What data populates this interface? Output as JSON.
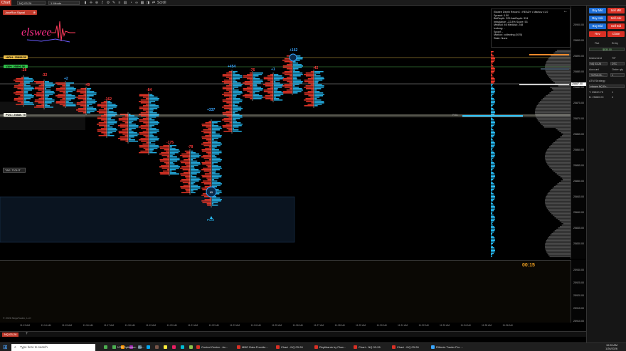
{
  "toolbar": {
    "chart_tab": "Chart",
    "instrument": "NQ 03-26",
    "interval": "1 Minute",
    "scroll_label": "Scroll"
  },
  "logo": {
    "badge": "JoseRon Signal",
    "wordmark": "elswee"
  },
  "levels": {
    "vah": "VAH: 25896.50",
    "val": "VAH: 25896.50",
    "high_label": "HIGH: 25898.50",
    "val_label": "VAH: 25896.50",
    "poc_label": "POC: 25880.75",
    "poc_right": "POC"
  },
  "tag_tight": "TAE: TIGHT",
  "deltas": [
    {
      "text": "-28",
      "color": "red"
    },
    {
      "text": "-32",
      "color": "red"
    },
    {
      "text": "+2",
      "color": "blue"
    },
    {
      "text": "-49",
      "color": "red"
    },
    {
      "text": "-162",
      "color": "red"
    },
    {
      "text": "-84",
      "color": "red"
    },
    {
      "text": "-175",
      "color": "red"
    },
    {
      "text": "-78",
      "color": "red"
    },
    {
      "text": "+337",
      "color": "blue"
    },
    {
      "text": "+454",
      "color": "blue"
    },
    {
      "text": "-76",
      "color": "red"
    },
    {
      "text": "+1",
      "color": "blue"
    },
    {
      "text": "+162",
      "color": "blue"
    },
    {
      "text": "-42",
      "color": "red"
    }
  ],
  "push_label": "Push",
  "dom_panel": {
    "title": "Elswee Depth ReconX  •  READY  •  Markov v1.0",
    "spread": "Spread: 0.50",
    "depth": "BidDepth: 325   AskDepth: 534",
    "imbalance": "Imbalance: -22.8%   Score: 53",
    "medbid": "MedBid: 46   MedAsk: 248",
    "iceberg": "Iceberg: -",
    "spoof": "Spoof: -",
    "markov": "Markov: collecting (0/20)",
    "state": "State: None"
  },
  "price_axis": [
    "25900.00",
    "25895.00",
    "25890.00",
    "25885.00",
    "25880.00",
    "25875.00",
    "25870.00",
    "25865.00",
    "25860.00",
    "25855.00",
    "25850.00",
    "25845.00",
    "25840.00",
    "25835.00",
    "25830.00"
  ],
  "current_price": "25887.00",
  "lower_axis": [
    "25930.00",
    "25925.00",
    "25920.00",
    "25915.00",
    "25910.00"
  ],
  "timer": "00:15",
  "time_axis": [
    "11:13 AM",
    "11:14 AM",
    "11:15 AM",
    "11:16 AM",
    "11:17 AM",
    "11:18 AM",
    "11:19 AM",
    "11:20 AM",
    "11:21 AM",
    "11:22 AM",
    "11:23 AM",
    "11:24 AM",
    "11:25 AM",
    "11:26 AM",
    "11:27 AM",
    "11:28 AM",
    "11:29 AM",
    "11:30 AM",
    "11:31 AM",
    "11:32 AM",
    "11:33 AM",
    "11:34 AM",
    "11:35 AM",
    "11:36 AM"
  ],
  "copyright": "© 2026 NinjaTrader, LLC",
  "bottom_tab": "NQ 03-26",
  "trade_panel": {
    "buy_mkt": "Buy Mkt",
    "sell_mkt": "Sell Mkt",
    "buy_ask": "Buy Ask",
    "sell_ask": "Sell Ask",
    "buy_bid": "Buy Bid",
    "sell_bid": "Sell Bid",
    "rev": "Rev",
    "close": "Close",
    "flat": "Flat",
    "entry": "Entry",
    "pnl": "$830.00",
    "instrument_lbl": "Instrument",
    "tif_lbl": "TIF",
    "instrument_val": "NQ 03-26",
    "tif_val": "DTC",
    "account_lbl": "Account",
    "order_qty_lbl": "Order qty",
    "account_val": "TDFM105...",
    "qty_val": "1",
    "atm_lbl": "ATM Strategy",
    "atm_val": "elswee NQ En...",
    "row1_lbl": "T: 25890.75",
    "row1_val": "1",
    "row2_lbl": "B: 25880.00",
    "row2_val": "4"
  },
  "taskbar": {
    "search": "Type here to search",
    "items": [
      {
        "label": "NT8 Optimizer - Go...",
        "color": "#4caf50"
      },
      {
        "label": "Control Center - Ac...",
        "color": "#d93025"
      },
      {
        "label": "MBO Data Provide...",
        "color": "#d93025"
      },
      {
        "label": "Chart - NQ 03-26",
        "color": "#d93025"
      },
      {
        "label": "Replikanto by Flow...",
        "color": "#d93025"
      },
      {
        "label": "Chart - NQ 03-26",
        "color": "#d93025"
      },
      {
        "label": "Chart - NQ 03-26",
        "color": "#d93025"
      },
      {
        "label": "Rithmic Trader Pro ...",
        "color": "#3aa7ff"
      }
    ],
    "time": "10:26 AM",
    "date": "1/26/2026"
  },
  "colors": {
    "bid": "#ff3b2b",
    "ask": "#29c4ff",
    "accent": "#c0392b"
  }
}
